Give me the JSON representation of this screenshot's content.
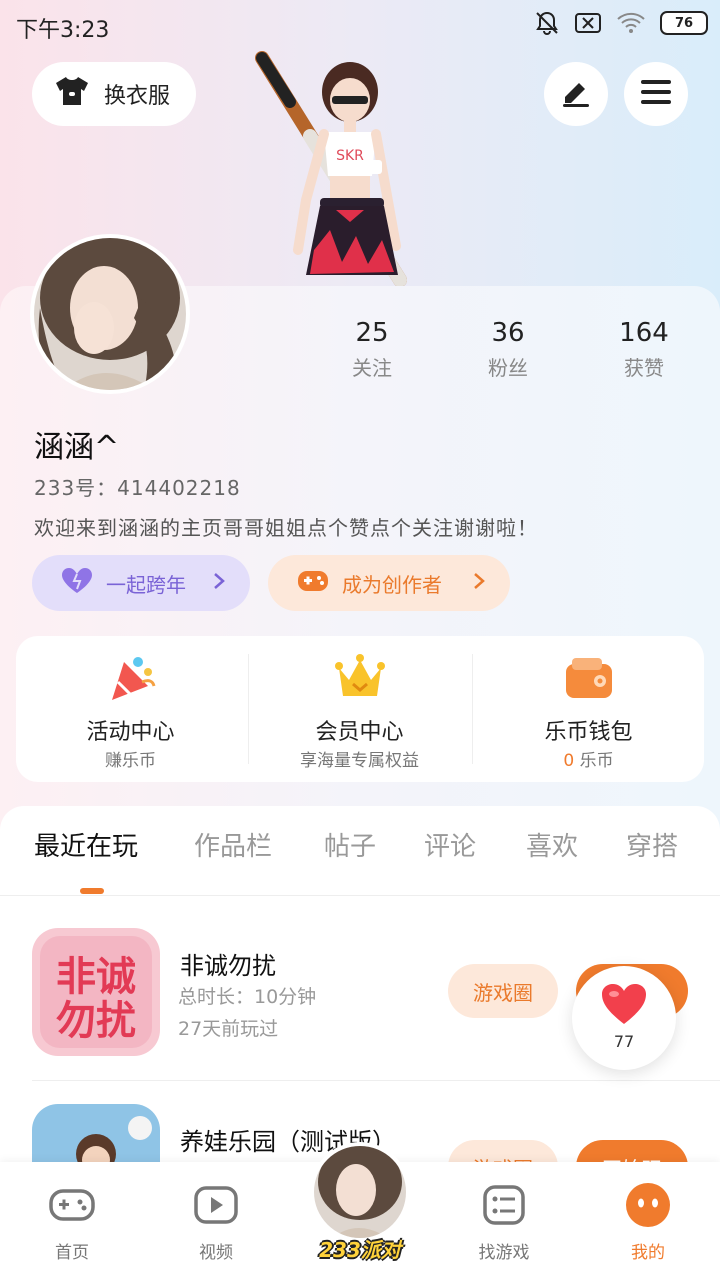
{
  "status_bar": {
    "time": "下午3:23",
    "battery": "76"
  },
  "header": {
    "outfit_label": "换衣服"
  },
  "profile": {
    "stats": [
      {
        "value": "25",
        "label": "关注"
      },
      {
        "value": "36",
        "label": "粉丝"
      },
      {
        "value": "164",
        "label": "获赞"
      }
    ],
    "nickname": "涵涵^",
    "uid": "233号：414402218",
    "bio": "欢迎来到涵涵的主页哥哥姐姐点个赞点个关注谢谢啦！",
    "pills": [
      {
        "label": "一起跨年"
      },
      {
        "label": "成为创作者"
      }
    ]
  },
  "features": [
    {
      "title": "活动中心",
      "subtitle": "赚乐币"
    },
    {
      "title": "会员中心",
      "subtitle": "享海量专属权益"
    },
    {
      "title": "乐币钱包",
      "subtitle_value": "0",
      "subtitle_unit": "乐币"
    }
  ],
  "tabs": [
    "最近在玩",
    "作品栏",
    "帖子",
    "评论",
    "喜欢",
    "穿搭"
  ],
  "active_tab": "最近在玩",
  "games": [
    {
      "name": "非诚勿扰",
      "icon_text": "非诚勿扰",
      "duration": "总时长：10分钟",
      "last_played": "27天前玩过",
      "circle_label": "游戏圈",
      "play_label": "开始玩"
    },
    {
      "name": "养娃乐园（测试版）",
      "duration": "",
      "last_played": "",
      "circle_label": "游戏圈",
      "play_label": "开始玩"
    }
  ],
  "floating_like": {
    "count": "77"
  },
  "bottom_nav": {
    "items": [
      {
        "label": "首页"
      },
      {
        "label": "视频"
      },
      {
        "label": "找游戏"
      },
      {
        "label": "我的"
      }
    ],
    "center_label": "233派对"
  },
  "colors": {
    "accent": "#f07b2d",
    "purple": "#7a63d6"
  }
}
